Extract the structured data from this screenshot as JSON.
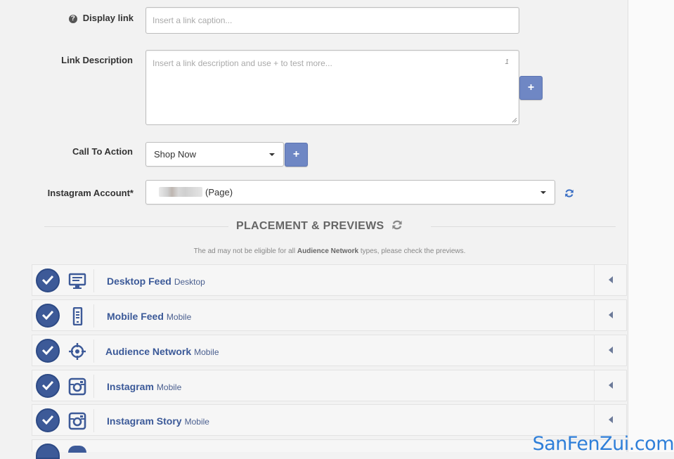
{
  "form": {
    "display_link_label": "Display link",
    "display_link_placeholder": "Insert a link caption...",
    "link_description_label": "Link Description",
    "link_description_placeholder": "Insert a link description and use + to test more...",
    "link_description_counter": "1",
    "plus_label": "+",
    "cta_label": "Call To Action",
    "cta_value": "Shop Now",
    "instagram_label": "Instagram Account*",
    "instagram_value": "(Page)"
  },
  "placement": {
    "title": "PLACEMENT & PREVIEWS",
    "note_pre": "The ad may not be eligible for all ",
    "note_bold": "Audience Network",
    "note_post": " types, please check the previews.",
    "items": [
      {
        "name": "Desktop Feed",
        "sub": "Desktop",
        "icon": "monitor-icon",
        "checked": true
      },
      {
        "name": "Mobile Feed",
        "sub": "Mobile",
        "icon": "mobile-phone-icon",
        "checked": true
      },
      {
        "name": "Audience Network",
        "sub": "Mobile",
        "icon": "target-icon",
        "checked": true
      },
      {
        "name": "Instagram",
        "sub": "Mobile",
        "icon": "instagram-icon",
        "checked": true
      },
      {
        "name": "Instagram Story",
        "sub": "Mobile",
        "icon": "instagram-icon",
        "checked": true
      }
    ]
  },
  "watermark": "SanFenZui.com",
  "colors": {
    "accent": "#3b5998",
    "button": "#6f87c4",
    "check": "#3d5a98",
    "watermark": "#2f7fd9"
  }
}
